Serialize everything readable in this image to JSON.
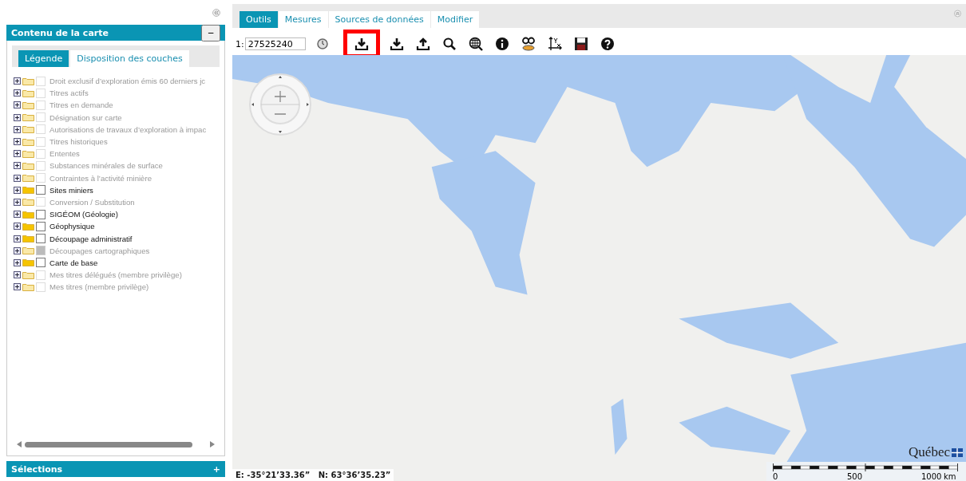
{
  "left_panel": {
    "title": "Contenu de la carte",
    "collapse_symbol": "−",
    "tabs": [
      {
        "label": "Légende",
        "selected": true
      },
      {
        "label": "Disposition des couches",
        "selected": false
      }
    ],
    "layers": [
      {
        "name": "Droit exclusif d’exploration émis 60 derniers jc",
        "kind": "inactive"
      },
      {
        "name": "Titres actifs",
        "kind": "inactive"
      },
      {
        "name": "Titres en demande",
        "kind": "inactive"
      },
      {
        "name": "Désignation sur carte",
        "kind": "inactive"
      },
      {
        "name": "Autorisations de travaux d’exploration à impac",
        "kind": "inactive"
      },
      {
        "name": "Titres historiques",
        "kind": "inactive"
      },
      {
        "name": "Ententes",
        "kind": "inactive"
      },
      {
        "name": "Substances minérales de surface",
        "kind": "inactive"
      },
      {
        "name": "Contraintes à l’activité minière",
        "kind": "inactive"
      },
      {
        "name": "Sites miniers",
        "kind": "active"
      },
      {
        "name": "Conversion / Substitution",
        "kind": "inactive"
      },
      {
        "name": "SIGÉOM (Géologie)",
        "kind": "active"
      },
      {
        "name": "Géophysique",
        "kind": "active"
      },
      {
        "name": "Découpage administratif",
        "kind": "active"
      },
      {
        "name": "Découpages cartographiques",
        "kind": "partial"
      },
      {
        "name": "Carte de base",
        "kind": "active"
      },
      {
        "name": "Mes titres délégués (membre privilège)",
        "kind": "inactive"
      },
      {
        "name": "Mes titres (membre privilège)",
        "kind": "inactive"
      }
    ],
    "selections": {
      "title": "Sélections",
      "expand_symbol": "+"
    }
  },
  "map_panel": {
    "tabs": [
      {
        "label": "Outils",
        "selected": true
      },
      {
        "label": "Mesures",
        "selected": false
      },
      {
        "label": "Sources de données",
        "selected": false
      },
      {
        "label": "Modifier",
        "selected": false
      }
    ],
    "scale_prefix": "1:",
    "scale_value": "27525240",
    "tools": [
      {
        "kind": "scale-clock",
        "highlighted": false
      },
      {
        "kind": "download-tray",
        "highlighted": true
      },
      {
        "kind": "download",
        "highlighted": false
      },
      {
        "kind": "upload",
        "highlighted": false
      },
      {
        "kind": "search",
        "highlighted": false
      },
      {
        "kind": "globe-search",
        "highlighted": false
      },
      {
        "kind": "info",
        "highlighted": false
      },
      {
        "kind": "binoculars",
        "highlighted": false
      },
      {
        "kind": "axes",
        "highlighted": false
      },
      {
        "kind": "save",
        "highlighted": false
      },
      {
        "kind": "help",
        "highlighted": false
      }
    ],
    "coordinates": "E: -35°21’33.36”   N: 63°36’35.23”",
    "logo": "Québec",
    "scale_labels": [
      "0",
      "500",
      "1000",
      "km"
    ]
  }
}
